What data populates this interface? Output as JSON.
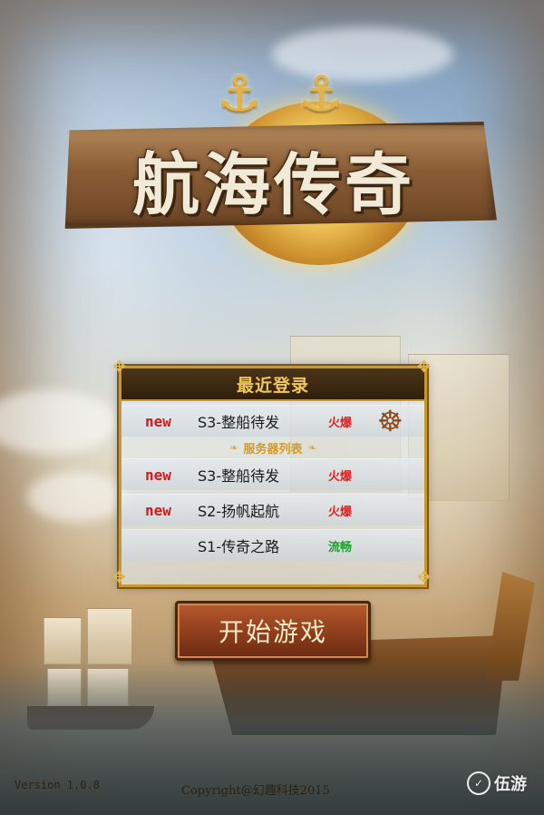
{
  "logo": {
    "title": "航海传奇"
  },
  "server_panel": {
    "recent_title": "最近登录",
    "recent": {
      "tag": "new",
      "name": "S3-整船待发",
      "status": "火爆"
    },
    "list_title": "服务器列表",
    "servers": [
      {
        "tag": "new",
        "name": "S3-整船待发",
        "status": "火爆"
      },
      {
        "tag": "new",
        "name": "S2-扬帆起航",
        "status": "火爆"
      },
      {
        "tag": "",
        "name": "S1-传奇之路",
        "status": "流畅"
      }
    ]
  },
  "start_button": "开始游戏",
  "footer": {
    "version": "Version 1.0.8",
    "copyright": "Copyright@幻趣科技2015"
  },
  "watermark": "伍游",
  "colors": {
    "hot": "#e32222",
    "smooth": "#1aa12c",
    "panel_border": "#c9972f"
  }
}
